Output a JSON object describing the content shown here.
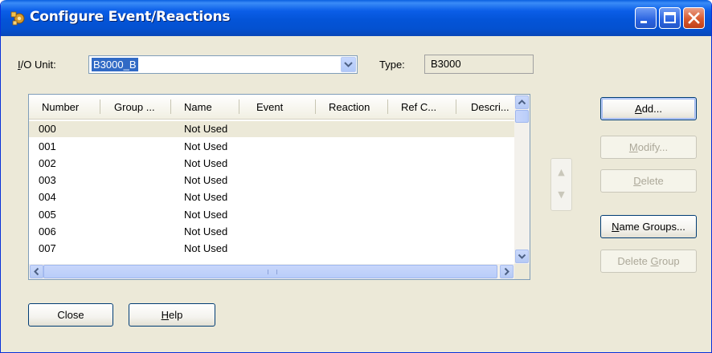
{
  "window": {
    "title": "Configure Event/Reactions"
  },
  "io_unit": {
    "label_mnemonic": "I",
    "label_rest": "/O Unit:",
    "value": "B3000_B"
  },
  "type": {
    "label": "Type:",
    "value": "B3000"
  },
  "list": {
    "columns": [
      "Number",
      "Group ...",
      "Name",
      "Event",
      "Reaction",
      "Ref C...",
      "Descri..."
    ],
    "rows": [
      {
        "number": "000",
        "name": "Not Used"
      },
      {
        "number": "001",
        "name": "Not Used"
      },
      {
        "number": "002",
        "name": "Not Used"
      },
      {
        "number": "003",
        "name": "Not Used"
      },
      {
        "number": "004",
        "name": "Not Used"
      },
      {
        "number": "005",
        "name": "Not Used"
      },
      {
        "number": "006",
        "name": "Not Used"
      },
      {
        "number": "007",
        "name": "Not Used"
      }
    ]
  },
  "buttons": {
    "add": {
      "mnemonic": "A",
      "rest": "dd..."
    },
    "modify": {
      "mnemonic": "M",
      "rest": "odify..."
    },
    "delete": {
      "mnemonic": "D",
      "rest": "elete"
    },
    "name_groups": {
      "mnemonic": "N",
      "rest": "ame Groups..."
    },
    "delete_group": {
      "before": "Delete ",
      "mnemonic": "G",
      "rest": "roup"
    },
    "close": {
      "label": "Close"
    },
    "help": {
      "mnemonic": "H",
      "rest": "elp"
    }
  },
  "icons": {
    "app": "app-gear-icon",
    "minimize": "minimize-icon",
    "maximize": "maximize-icon",
    "close": "close-icon"
  },
  "colors": {
    "titlebar": "#0454d8",
    "selection": "#316ac5",
    "dialog_bg": "#ece9d8"
  }
}
